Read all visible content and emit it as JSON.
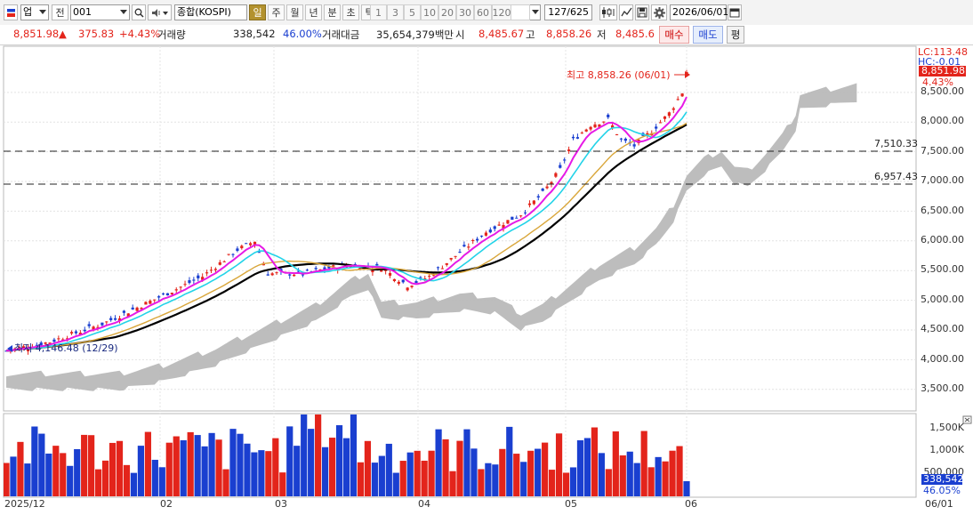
{
  "toolbar": {
    "market_label": "업",
    "type_label": "전",
    "code_value": "001",
    "name_value": "종합(KOSPI)",
    "periods": [
      "일",
      "주",
      "월",
      "년",
      "분",
      "초",
      "틱"
    ],
    "active_period": "일",
    "intervals": [
      "1",
      "3",
      "5",
      "10",
      "20",
      "30",
      "60",
      "120"
    ],
    "count_display": "127",
    "count_total": "/625",
    "date_value": "2026/06/01"
  },
  "quote": {
    "price": "8,851.98",
    "change_arrow": "▲",
    "change": "375.83",
    "change_rate": "+4.43%",
    "volume_label": "거래량",
    "volume": "338,542",
    "volume_ratio": "46.00%",
    "turnover_label": "거래대금",
    "turnover": "35,654,379백만",
    "open_label": "시",
    "open": "8,485.67",
    "high_label": "고",
    "high": "8,858.26",
    "low_label": "저",
    "low": "8,485.6",
    "buy_label": "매수",
    "sell_label": "매도",
    "avg_label": "평"
  },
  "price_axis": {
    "lc_label": "LC:113.48",
    "hc_label": "HC:-0.01",
    "current_price": "8,851.98",
    "current_change": "4.43%",
    "ticks": [
      "8,500.00",
      "8,000.00",
      "7,500.00",
      "7,000.00",
      "6,500.00",
      "6,000.00",
      "5,500.00",
      "5,000.00",
      "4,500.00",
      "4,000.00",
      "3,500.00"
    ]
  },
  "volume_axis": {
    "ticks": [
      "1,500K",
      "1,000K",
      "500,000"
    ],
    "current_volume": "338,542",
    "current_ratio": "46.05%"
  },
  "annotations": {
    "high_note": "최고 8,858.26 (06/01)",
    "low_note": "최저 4,146.48 (12/29)",
    "line1": "7,510.33",
    "line2": "6,957.43"
  },
  "x_axis": {
    "labels": [
      "2025/12",
      "02",
      "03",
      "04",
      "05",
      "06"
    ],
    "right_label": "06/01"
  },
  "colors": {
    "up": "#e3241b",
    "down": "#1a3fd0",
    "ma_short": "#e61ae6",
    "ma_mid": "#23d3e8",
    "ma_long": "#d9a63a",
    "ma_base": "#000000",
    "cloud": "#b9b9b9"
  }
}
